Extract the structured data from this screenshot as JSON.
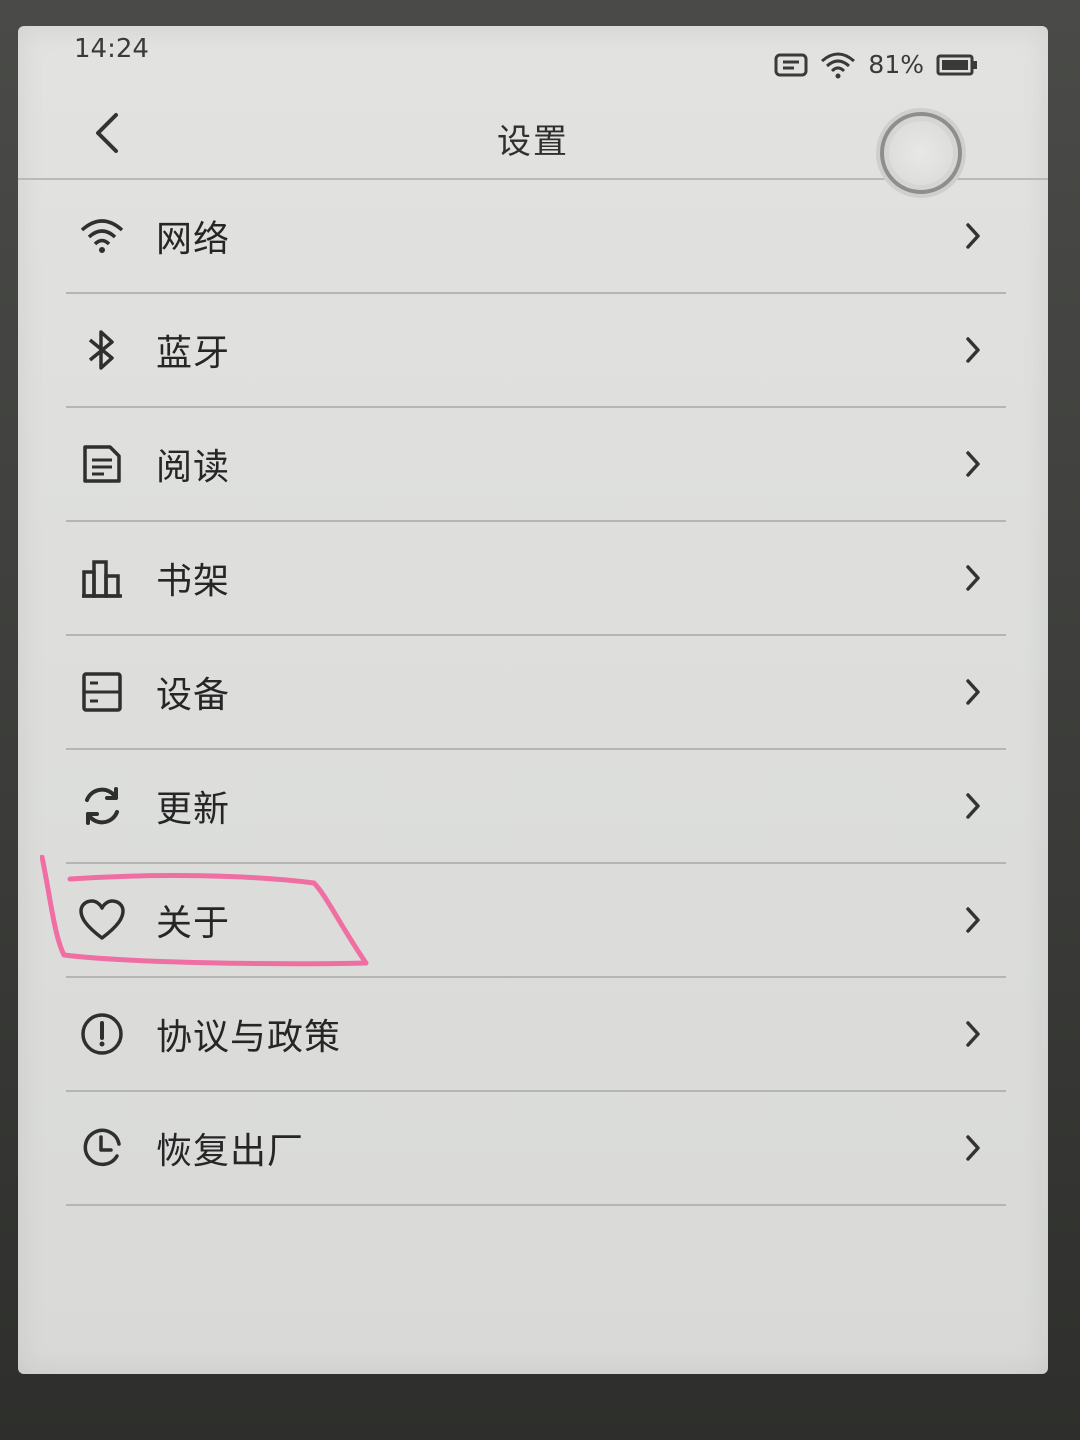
{
  "status_bar": {
    "time": "14:24",
    "battery_percent": "81%",
    "icons": [
      "message-icon",
      "wifi-icon",
      "battery-icon"
    ]
  },
  "header": {
    "title": "设置",
    "back_icon": "chevron-left-icon"
  },
  "menu": {
    "items": [
      {
        "label": "网络",
        "icon": "wifi-icon"
      },
      {
        "label": "蓝牙",
        "icon": "bluetooth-icon"
      },
      {
        "label": "阅读",
        "icon": "document-icon"
      },
      {
        "label": "书架",
        "icon": "bookshelf-icon"
      },
      {
        "label": "设备",
        "icon": "device-icon"
      },
      {
        "label": "更新",
        "icon": "refresh-icon"
      },
      {
        "label": "关于",
        "icon": "heart-icon"
      },
      {
        "label": "协议与政策",
        "icon": "info-circle-icon"
      },
      {
        "label": "恢复出厂",
        "icon": "clock-reset-icon"
      }
    ]
  },
  "colors": {
    "screen_bg": "#dedfdd",
    "text": "#262626",
    "divider": "#b5b6b4",
    "annotation": "#ef6fa3"
  }
}
